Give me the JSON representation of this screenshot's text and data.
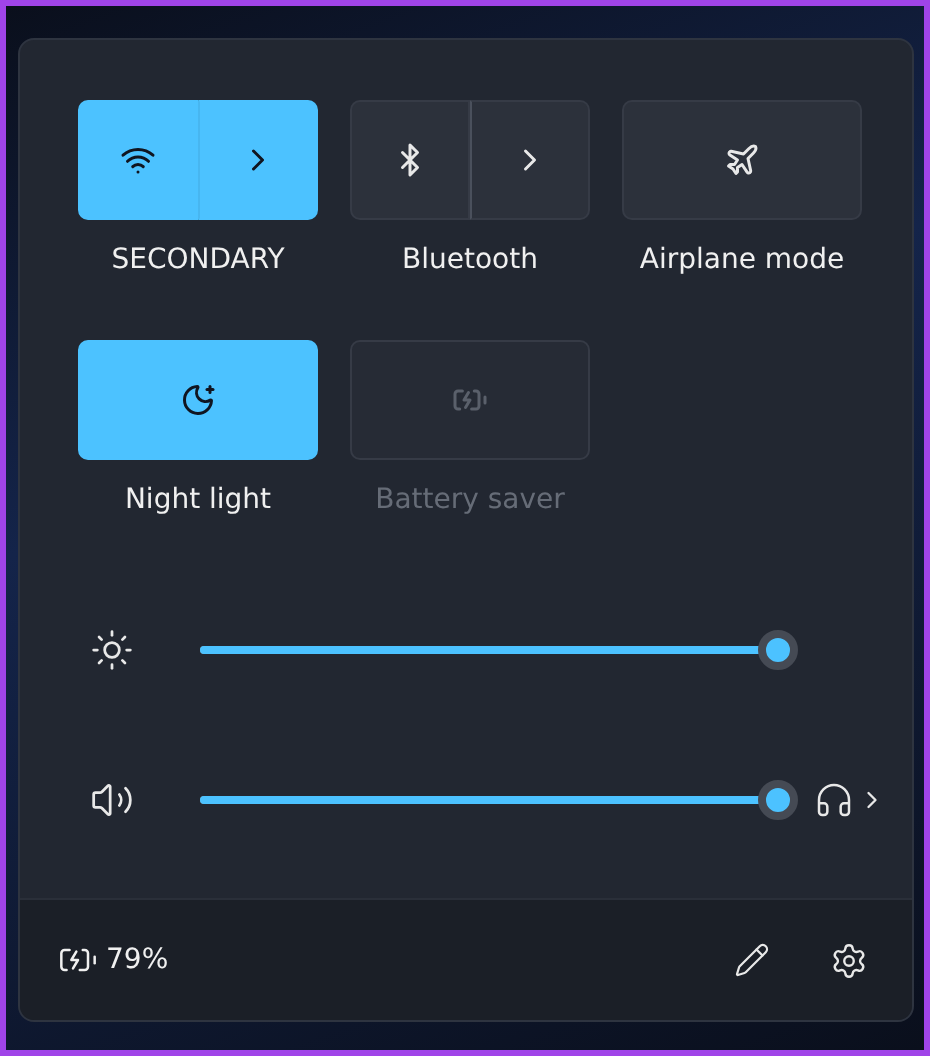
{
  "tiles": [
    {
      "label": "SECONDARY",
      "kind": "split",
      "on": true,
      "disabled": false
    },
    {
      "label": "Bluetooth",
      "kind": "split",
      "on": false,
      "disabled": false
    },
    {
      "label": "Airplane mode",
      "kind": "single",
      "on": false,
      "disabled": false
    },
    {
      "label": "Night light",
      "kind": "single",
      "on": true,
      "disabled": false
    },
    {
      "label": "Battery saver",
      "kind": "single",
      "on": false,
      "disabled": true
    }
  ],
  "sliders": [
    {
      "kind": "brightness",
      "level": 1
    },
    {
      "kind": "volume",
      "level": 1
    }
  ],
  "footer": {
    "battery": "79%"
  }
}
